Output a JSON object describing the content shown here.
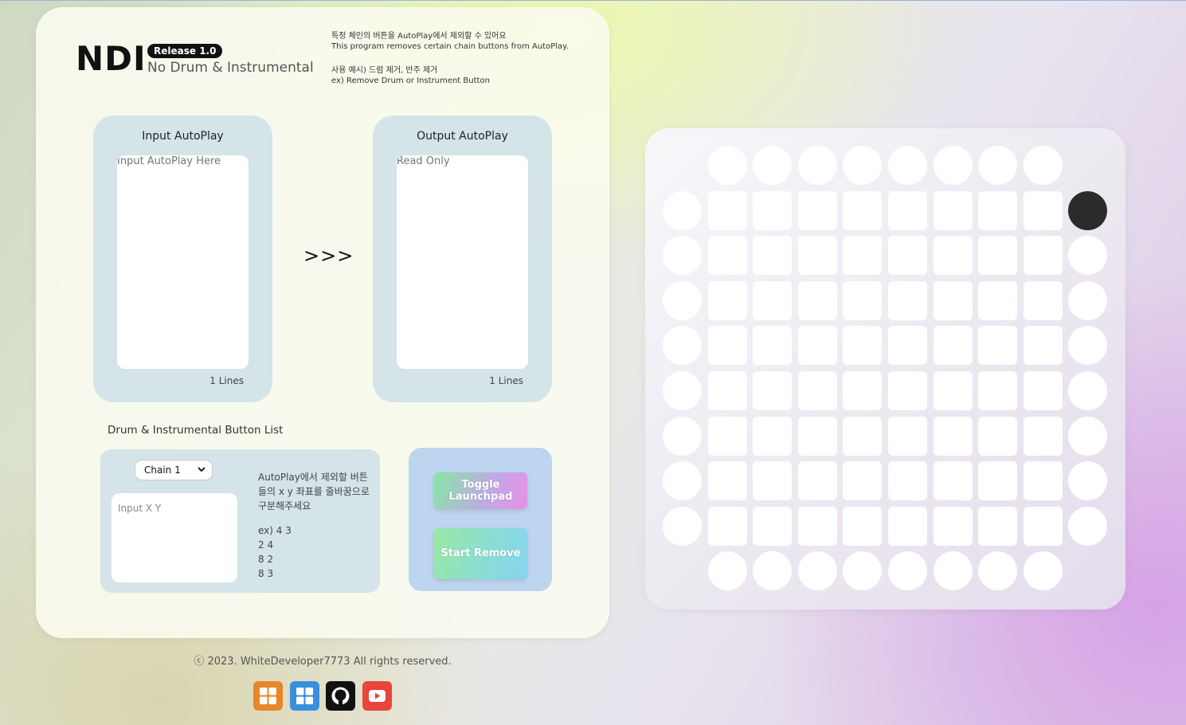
{
  "header": {
    "logo": "NDI",
    "badge": "Release 1.0",
    "subtitle": "No Drum & Instrumental",
    "desc_ko_1": "특정 체인의 버튼을 AutoPlay에서 제외할 수 있어요",
    "desc_en_1": "This program removes certain chain buttons from AutoPlay.",
    "desc_ko_2": "사용 예시) 드럼 제거, 반주 제거",
    "desc_en_2": "ex) Remove Drum or Instrument Button"
  },
  "input_panel": {
    "title": "Input AutoPlay",
    "placeholder": "Input AutoPlay Here",
    "lines": "1 Lines"
  },
  "output_panel": {
    "title": "Output AutoPlay",
    "placeholder": "Read Only",
    "lines": "1 Lines"
  },
  "arrow": ">>>",
  "button_list": {
    "title": "Drum & Instrumental Button List",
    "chain_select": "Chain 1",
    "xy_placeholder": "Input X Y",
    "help_text": "AutoPlay에서 제외할 버튼들의 x y 좌표를 줄바꿈으로 구분해주세요",
    "example_lines": [
      "ex) 4 3",
      "2 4",
      "8 2",
      "8 3"
    ]
  },
  "actions": {
    "toggle_label": "Toggle Launchpad",
    "start_label": "Start Remove"
  },
  "footer": {
    "copyright": "ⓒ 2023. WhiteDeveloper7773 All rights reserved."
  },
  "social_icons": [
    {
      "name": "windows-icon",
      "color": "#e8862a"
    },
    {
      "name": "windows-icon",
      "color": "#3a8fdc"
    },
    {
      "name": "github-icon",
      "color": "#111111"
    },
    {
      "name": "youtube-icon",
      "color": "#e8453c"
    }
  ],
  "launchpad": {
    "active_button": {
      "row": 1,
      "col": 9
    },
    "pad_color": "#ffffff",
    "active_color": "#2b2b2b"
  }
}
